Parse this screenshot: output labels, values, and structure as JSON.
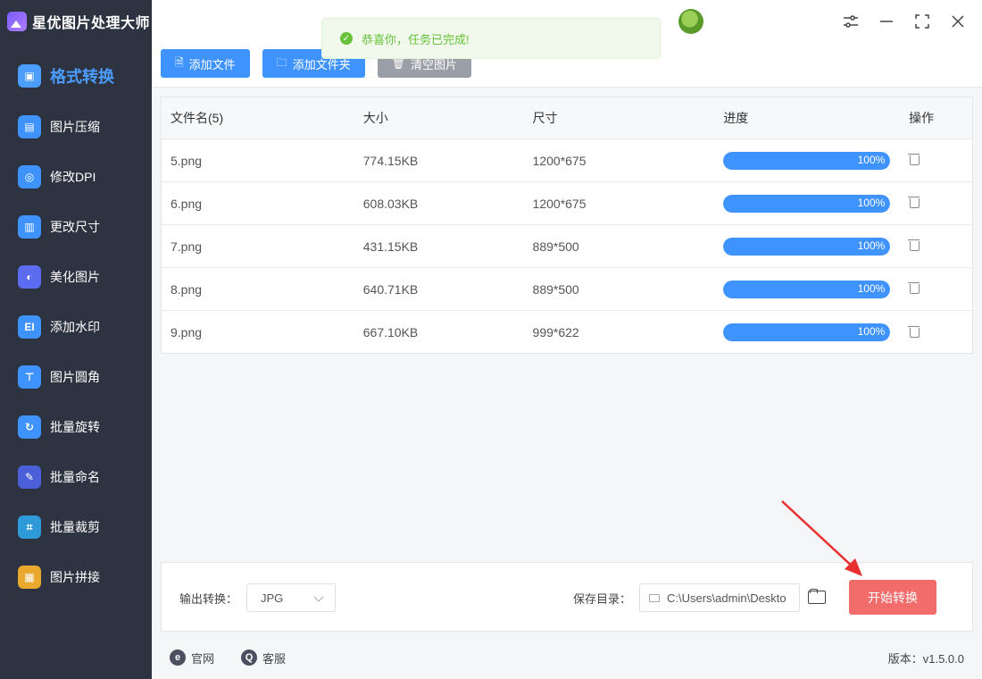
{
  "app": {
    "title": "星优图片处理大师"
  },
  "sidebar": {
    "items": [
      {
        "label": "格式转换",
        "icon": "image-convert-icon",
        "color": "#4b9dff",
        "active": true
      },
      {
        "label": "图片压缩",
        "icon": "image-compress-icon",
        "color": "#3f93ff"
      },
      {
        "label": "修改DPI",
        "icon": "dpi-icon",
        "color": "#3f93ff"
      },
      {
        "label": "更改尺寸",
        "icon": "resize-icon",
        "color": "#3f93ff"
      },
      {
        "label": "美化图片",
        "icon": "beautify-icon",
        "color": "#5b6cf0"
      },
      {
        "label": "添加水印",
        "icon": "watermark-icon",
        "color": "#3f93ff"
      },
      {
        "label": "图片圆角",
        "icon": "round-corner-icon",
        "color": "#3f93ff"
      },
      {
        "label": "批量旋转",
        "icon": "rotate-icon",
        "color": "#3f93ff"
      },
      {
        "label": "批量命名",
        "icon": "rename-icon",
        "color": "#4a5fd8"
      },
      {
        "label": "批量裁剪",
        "icon": "crop-icon",
        "color": "#2f9ad8"
      },
      {
        "label": "图片拼接",
        "icon": "puzzle-icon",
        "color": "#e9a82e"
      }
    ]
  },
  "toolbar": {
    "add_file": "添加文件",
    "add_folder": "添加文件夹",
    "clear": "清空图片"
  },
  "toast": {
    "message": "恭喜你，任务已完成!",
    "icon": "check-circle-icon"
  },
  "table": {
    "headers": [
      "文件名(5)",
      "大小",
      "尺寸",
      "进度",
      "操作"
    ],
    "rows": [
      {
        "name": "5.png",
        "size": "774.15KB",
        "dims": "1200*675",
        "progress": "100%",
        "progress_value": 1.0
      },
      {
        "name": "6.png",
        "size": "608.03KB",
        "dims": "1200*675",
        "progress": "100%",
        "progress_value": 1.0
      },
      {
        "name": "7.png",
        "size": "431.15KB",
        "dims": "889*500",
        "progress": "100%",
        "progress_value": 1.0
      },
      {
        "name": "8.png",
        "size": "640.71KB",
        "dims": "889*500",
        "progress": "100%",
        "progress_value": 1.0
      },
      {
        "name": "9.png",
        "size": "667.10KB",
        "dims": "999*622",
        "progress": "100%",
        "progress_value": 1.0
      }
    ]
  },
  "bottom": {
    "output_label": "输出转换：",
    "format_value": "JPG",
    "save_label": "保存目录：",
    "save_path": "C:\\Users\\admin\\Deskto",
    "start_button": "开始转换"
  },
  "footer": {
    "site_label": "官网",
    "service_label": "客服",
    "version": "版本：v1.5.0.0"
  },
  "colors": {
    "sidebar_bg": "#2d3340",
    "accent_blue": "#3f93ff",
    "start_red": "#f36c6c",
    "toast_green": "#67c23a"
  }
}
